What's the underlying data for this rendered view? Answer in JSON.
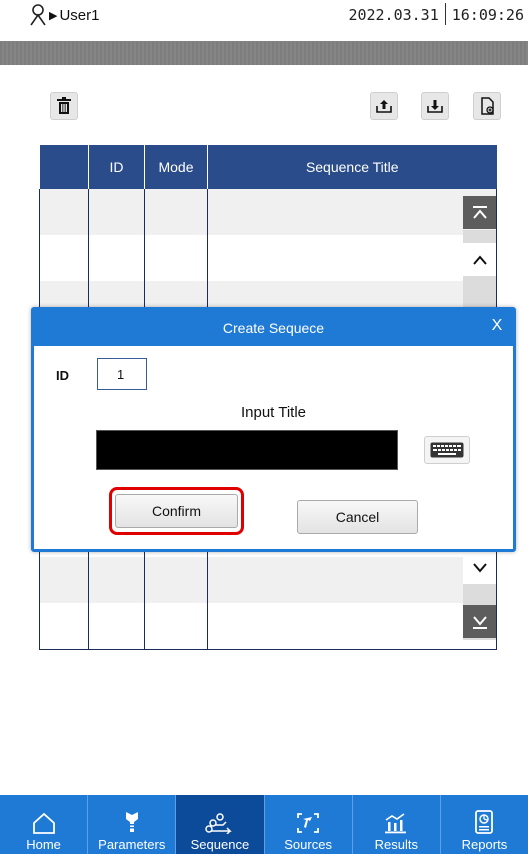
{
  "header": {
    "user": "User1",
    "date": "2022.03.31",
    "time": "16:09:26"
  },
  "table": {
    "columns": [
      "",
      "ID",
      "Mode",
      "Sequence Title"
    ]
  },
  "dialog": {
    "title": "Create Sequece",
    "close_label": "X",
    "id_label": "ID",
    "id_value": "1",
    "input_title_label": "Input Title",
    "title_value": "",
    "confirm_label": "Confirm",
    "cancel_label": "Cancel"
  },
  "nav": {
    "items": [
      {
        "label": "Home",
        "icon": "home-icon"
      },
      {
        "label": "Parameters",
        "icon": "parameters-icon"
      },
      {
        "label": "Sequence",
        "icon": "sequence-icon"
      },
      {
        "label": "Sources",
        "icon": "sources-icon"
      },
      {
        "label": "Results",
        "icon": "results-icon"
      },
      {
        "label": "Reports",
        "icon": "reports-icon"
      }
    ],
    "active": "Sequence"
  },
  "colors": {
    "accent": "#1f7ad6",
    "table_header": "#2a4c8a",
    "highlight": "#e00000",
    "nav_active": "#0c4a9a"
  }
}
